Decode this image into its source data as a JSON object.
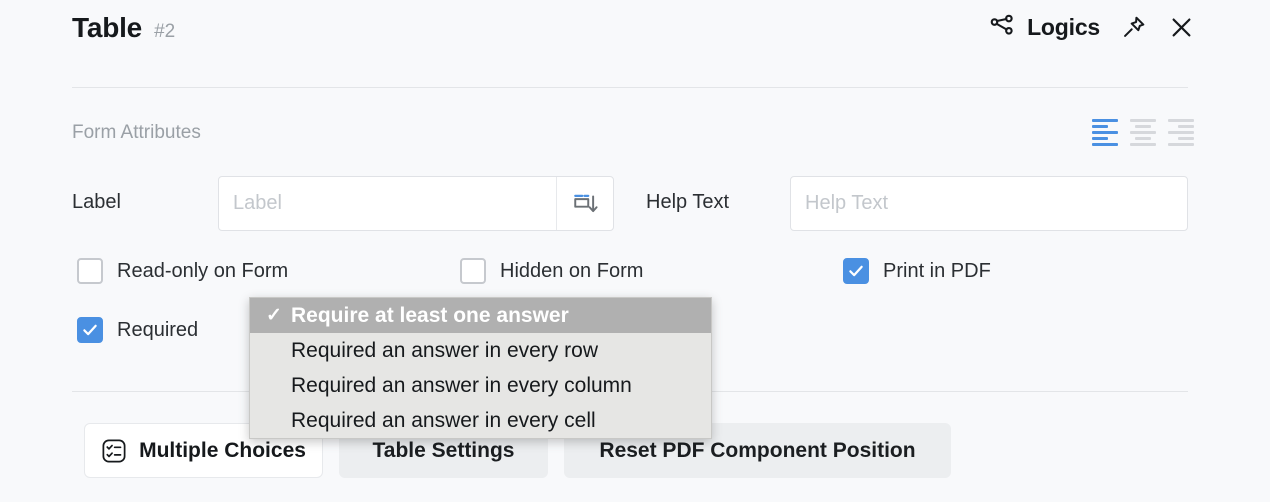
{
  "header": {
    "title": "Table",
    "index": "#2",
    "logics_label": "Logics",
    "logics_icon": "share-nodes-icon",
    "pin_icon": "pin-icon",
    "close_icon": "close-icon"
  },
  "form_attributes": {
    "section_label": "Form Attributes",
    "alignment": {
      "selected": "left",
      "options": [
        "left",
        "center",
        "right"
      ],
      "active_color": "#4a90e2",
      "inactive_color": "#d6d8dc"
    },
    "fields": [
      {
        "label": "Label",
        "value": "",
        "placeholder": "Label",
        "addon_icon": "insert-below-icon"
      },
      {
        "label": "Help Text",
        "value": "",
        "placeholder": "Help Text"
      }
    ],
    "checkboxes": [
      {
        "label": "Read-only on Form",
        "checked": false
      },
      {
        "label": "Hidden on Form",
        "checked": false
      },
      {
        "label": "Print in PDF",
        "checked": true
      },
      {
        "label": "Required",
        "checked": true
      }
    ],
    "checkbox_checked_color": "#4a90e2"
  },
  "dropdown": {
    "visible": true,
    "selected_index": 0,
    "check_glyph": "✓",
    "highlight_color": "#b0b0b0",
    "background_color": "#e6e6e4",
    "items": [
      "Require at least one answer",
      "Required an answer in every row",
      "Required an answer in every column",
      "Required an answer in every cell"
    ]
  },
  "buttons": [
    {
      "label": "Multiple Choices",
      "icon": "checklist-icon",
      "style": "outline"
    },
    {
      "label": "Table Settings",
      "icon": "",
      "style": "muted"
    },
    {
      "label": "Reset PDF Component Position",
      "icon": "",
      "style": "muted"
    }
  ]
}
